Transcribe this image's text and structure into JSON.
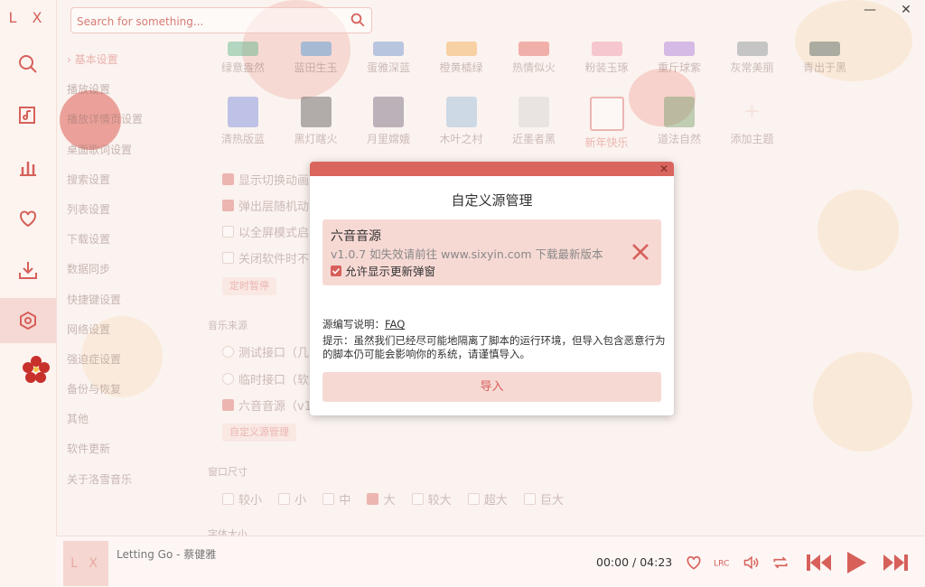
{
  "app": {
    "logo": "L X"
  },
  "sidebar": {
    "items": [
      "search-icon",
      "music-library-icon",
      "chart-icon",
      "heart-icon",
      "download-icon",
      "settings-icon"
    ],
    "active": 5
  },
  "search": {
    "placeholder": "Search for something..."
  },
  "window": {
    "minimize": "—",
    "close": "✕"
  },
  "settings_nav": [
    "基本设置",
    "播放设置",
    "播放详情页设置",
    "桌面歌词设置",
    "搜索设置",
    "列表设置",
    "下载设置",
    "数据同步",
    "快捷键设置",
    "网络设置",
    "强迫症设置",
    "备份与恢复",
    "其他",
    "软件更新",
    "关于洛雪音乐"
  ],
  "themes": [
    {
      "name": "绿意盎然",
      "color": "#4daf7c"
    },
    {
      "name": "蓝田生玉",
      "color": "#3a8fd6"
    },
    {
      "name": "蛋雅深蓝",
      "color": "#5b86c9"
    },
    {
      "name": "橙黄橘绿",
      "color": "#f0a23b"
    },
    {
      "name": "热情似火",
      "color": "#e3514a"
    },
    {
      "name": "粉装玉琢",
      "color": "#f08aa0"
    },
    {
      "name": "重斤球紫",
      "color": "#a16bd8"
    },
    {
      "name": "灰常美丽",
      "color": "#7a858e"
    },
    {
      "name": "青出于黑",
      "color": "#3f5a56"
    },
    {
      "name": "清热版蓝",
      "color": "#6a7fd8"
    },
    {
      "name": "黑灯瞎火",
      "color": "#4a4a4a"
    },
    {
      "name": "月里嫦娥",
      "color": "#605a6c"
    },
    {
      "name": "木叶之村",
      "color": "#8fb6d8"
    },
    {
      "name": "近墨者黑",
      "color": "#cfcfcf"
    },
    {
      "name": "新年快乐",
      "color": "#ffffff"
    },
    {
      "name": "道法自然",
      "color": "#6b9a61"
    },
    {
      "name": "添加主题",
      "color": "#f3c7c0"
    }
  ],
  "options": {
    "opt1": "显示切换动画",
    "opt2": "弹出层随机动",
    "opt3": "以全屏模式启",
    "opt4": "关闭软件时不",
    "timer_btn": "定时暂停",
    "music_source_title": "音乐来源",
    "src1": "测试接口（几",
    "src2": "临时接口（软",
    "src3": "六音音源（v1",
    "custom_src_btn": "自定义源管理",
    "window_size_title": "窗口尺寸",
    "sizes": [
      "较小",
      "小",
      "中",
      "大",
      "较大",
      "超大",
      "巨大"
    ],
    "font_size_title": "字体大小"
  },
  "dialog": {
    "title": "自定义源管理",
    "close": "✕",
    "source_name": "六音音源",
    "source_desc": "v1.0.7 如失效请前往 www.sixyin.com 下载最新版本",
    "allow_update_popup": "允许显示更新弹窗",
    "help_label": "源编写说明：",
    "help_link": "FAQ",
    "tip": "提示：虽然我们已经尽可能地隔离了脚本的运行环境，但导入包含恶意行为的脚本仍可能会影响你的系统，请谨慎导入。",
    "import_button": "导入"
  },
  "player": {
    "cover": "L X",
    "song": "Letting Go - 蔡健雅",
    "current_time": "00:00",
    "separator": "/",
    "duration": "04:23"
  },
  "colors": {
    "accent": "#d7605a",
    "accent_light": "#f7d9d4"
  }
}
